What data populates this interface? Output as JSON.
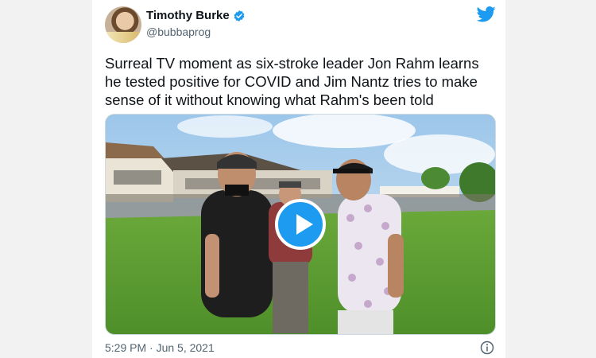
{
  "tweet": {
    "display_name": "Timothy Burke",
    "handle": "@bubbaprog",
    "verified": true,
    "text": "Surreal TV moment as six-stroke leader Jon Rahm learns he tested positive for COVID and Jim Nantz tries to make sense of it without knowing what Rahm's been told",
    "timestamp": "5:29 PM · Jun 5, 2021"
  },
  "icons": {
    "logo": "twitter-bird-icon",
    "verified": "verified-badge-icon",
    "info": "info-icon",
    "play": "play-icon"
  },
  "colors": {
    "brand": "#1d9bf0",
    "text": "#0f1419",
    "muted": "#536471"
  }
}
